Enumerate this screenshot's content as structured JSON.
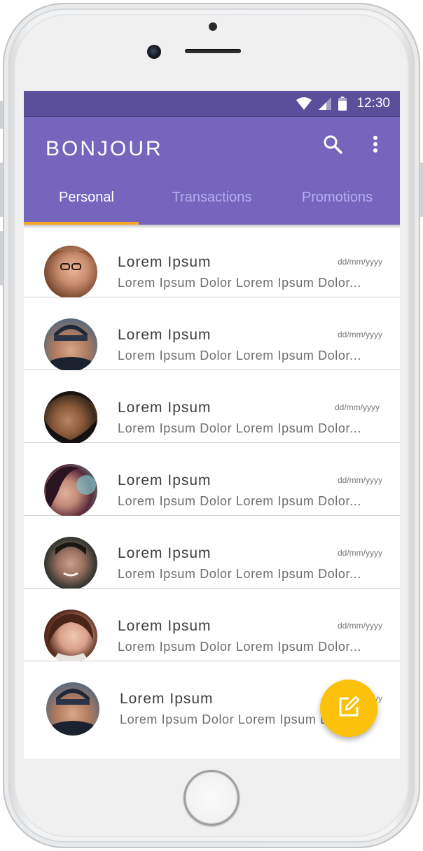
{
  "status_bar": {
    "time": "12:30",
    "icons": [
      "wifi-icon",
      "signal-icon",
      "battery-icon"
    ]
  },
  "app_bar": {
    "title": "BONJOUR",
    "actions": [
      "search-icon",
      "more-vert-icon"
    ]
  },
  "tabs": [
    {
      "label": "Personal",
      "active": true
    },
    {
      "label": "Transactions",
      "active": false
    },
    {
      "label": "Promotions",
      "active": false
    }
  ],
  "conversations": [
    {
      "name": "Lorem Ipsum",
      "date": "dd/mm/yyyy",
      "preview": "Lorem Ipsum Dolor Lorem Ipsum Dolor..."
    },
    {
      "name": "Lorem Ipsum",
      "date": "dd/mm/yyyy",
      "preview": "Lorem Ipsum Dolor Lorem Ipsum Dolor..."
    },
    {
      "name": "Lorem Ipsum",
      "date": "dd/mm/yyyy",
      "preview": "Lorem Ipsum Dolor Lorem Ipsum Dolor..."
    },
    {
      "name": "Lorem Ipsum",
      "date": "dd/mm/yyyy",
      "preview": "Lorem Ipsum Dolor Lorem Ipsum Dolor..."
    },
    {
      "name": "Lorem Ipsum",
      "date": "dd/mm/yyyy",
      "preview": "Lorem Ipsum Dolor Lorem Ipsum Dolor..."
    },
    {
      "name": "Lorem Ipsum",
      "date": "dd/mm/yyyy",
      "preview": "Lorem Ipsum Dolor Lorem Ipsum Dolor..."
    },
    {
      "name": "Lorem Ipsum",
      "date": "dd/mm/yyyy",
      "preview": "Lorem Ipsum Dolor Lorem Ipsum Dolor..."
    }
  ],
  "fab": {
    "icon": "compose-icon"
  },
  "colors": {
    "status_bar": "#5b4e9a",
    "primary": "#7565bd",
    "tab_indicator": "#f5a623",
    "fab": "#fcc10a"
  }
}
